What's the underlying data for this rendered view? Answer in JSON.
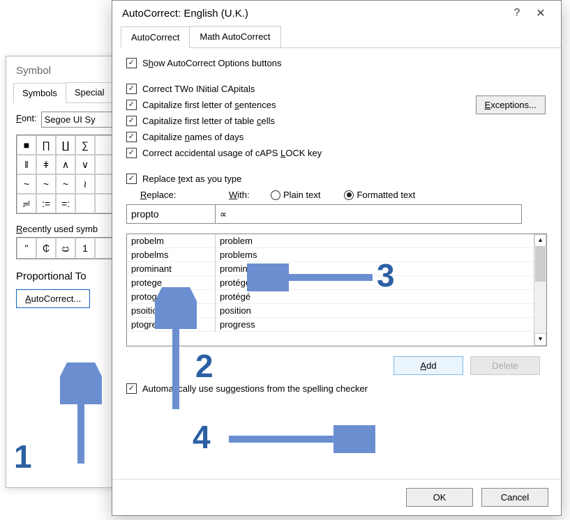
{
  "symbol_dialog": {
    "title": "Symbol",
    "tabs": {
      "symbols": "Symbols",
      "special": "Special"
    },
    "font_label": "Font:",
    "font_value": "Segoe UI Sy",
    "grid_chars": [
      "■",
      "∏",
      "∐",
      "∑",
      "",
      "‖",
      "ǂ",
      "∧",
      "∨",
      "",
      "~",
      "~",
      "~",
      "≀",
      "",
      "≓",
      ":=",
      "=:",
      "",
      ""
    ],
    "recent_label": "Recently used symb",
    "recent_chars": [
      "\"",
      "₵",
      "ඏ",
      "1",
      ""
    ],
    "prop_label": "Proportional To",
    "autocorrect_btn": "AutoCorrect..."
  },
  "ac_dialog": {
    "title": "AutoCorrect: English (U.K.)",
    "help": "?",
    "close": "✕",
    "tabs": {
      "auto": "AutoCorrect",
      "math": "Math AutoCorrect"
    },
    "checks": {
      "show": "Show AutoCorrect Options buttons",
      "two": "Correct TWo INitial CApitals",
      "sent": "Capitalize first letter of sentences",
      "cells": "Capitalize first letter of table cells",
      "days": "Capitalize names of days",
      "caps": "Correct accidental usage of cAPS LOCK key",
      "repl": "Replace text as you type",
      "sugg": "Automatically use suggestions from the spelling checker"
    },
    "exceptions_btn": "Exceptions...",
    "replace_label": "Replace:",
    "with_label": "With:",
    "plain_label": "Plain text",
    "formatted_label": "Formatted text",
    "replace_value": "propto",
    "with_value": "∝",
    "list": [
      {
        "l": "probelm",
        "r": "problem"
      },
      {
        "l": "probelms",
        "r": "problems"
      },
      {
        "l": "prominant",
        "r": "prominent"
      },
      {
        "l": "protege",
        "r": "protégé"
      },
      {
        "l": "protoge",
        "r": "protégé"
      },
      {
        "l": "psoition",
        "r": "position"
      },
      {
        "l": "ptogress",
        "r": "progress"
      }
    ],
    "add_btn": "Add",
    "delete_btn": "Delete",
    "ok_btn": "OK",
    "cancel_btn": "Cancel"
  },
  "annotations": {
    "n1": "1",
    "n2": "2",
    "n3": "3",
    "n4": "4"
  }
}
